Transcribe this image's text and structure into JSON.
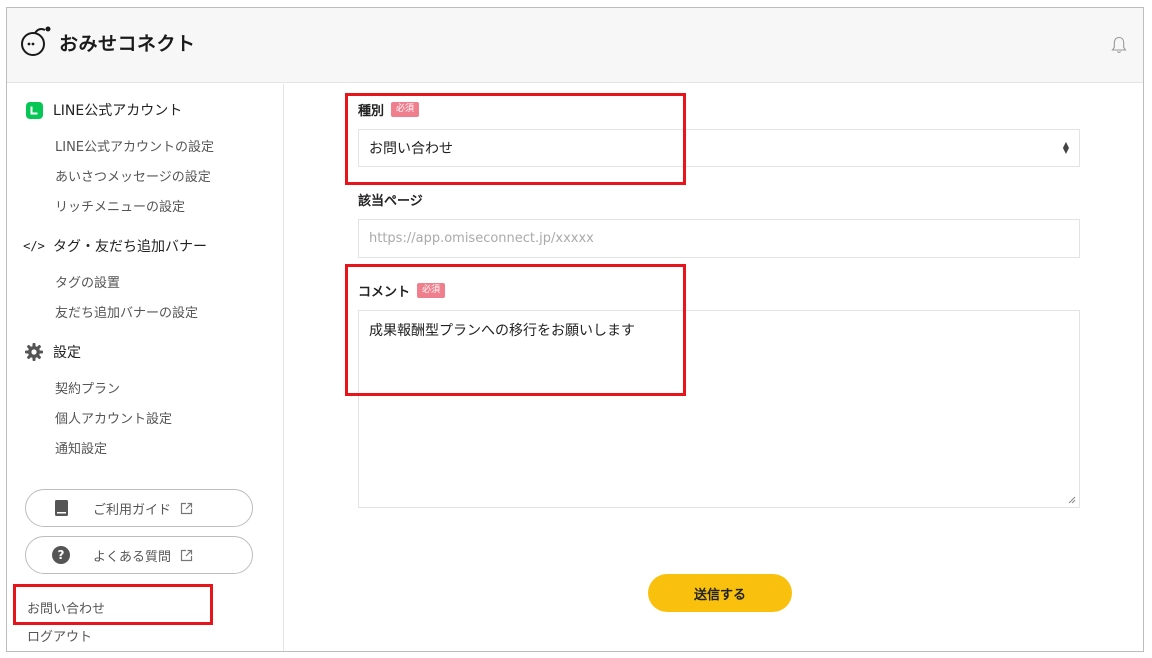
{
  "app": {
    "name": "おみせコネクト"
  },
  "sidebar": {
    "sections": [
      {
        "icon": "line-icon",
        "label": "LINE公式アカウント",
        "items": [
          "LINE公式アカウントの設定",
          "あいさつメッセージの設定",
          "リッチメニューの設定"
        ]
      },
      {
        "icon": "code-icon",
        "label": "タグ・友だち追加バナー",
        "items": [
          "タグの設置",
          "友だち追加バナーの設定"
        ]
      },
      {
        "icon": "gear-icon",
        "label": "設定",
        "items": [
          "契約プラン",
          "個人アカウント設定",
          "通知設定"
        ]
      }
    ],
    "guide_label": "ご利用ガイド",
    "faq_label": "よくある質問",
    "contact_label": "お問い合わせ",
    "logout_label": "ログアウト"
  },
  "form": {
    "type_label": "種別",
    "required_badge": "必須",
    "type_value": "お問い合わせ",
    "page_label": "該当ページ",
    "page_placeholder": "https://app.omiseconnect.jp/xxxxx",
    "comment_label": "コメント",
    "comment_value": "成果報酬型プランへの移行をお願いします",
    "submit_label": "送信する"
  },
  "colors": {
    "accent": "#f9c10d",
    "required_badge": "#f07f8e",
    "highlight": "#e8141c",
    "line_green": "#06c755"
  }
}
